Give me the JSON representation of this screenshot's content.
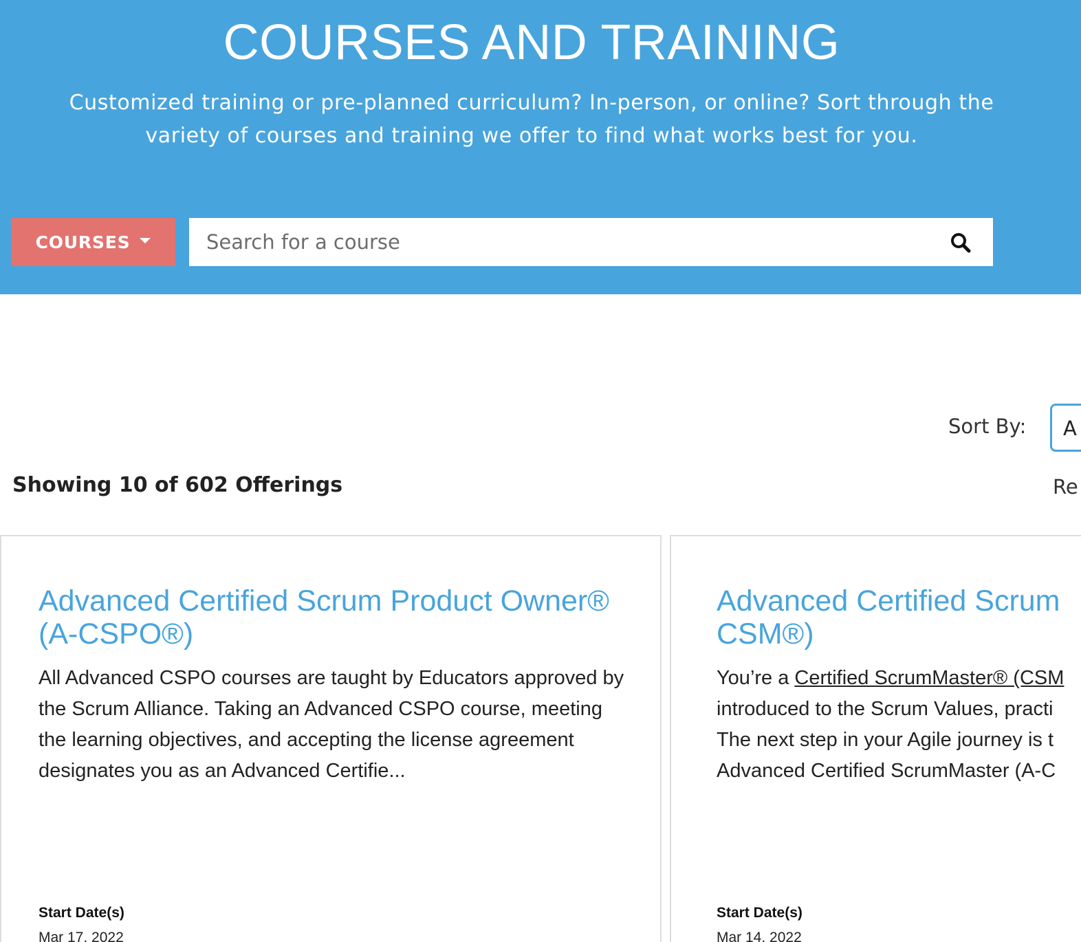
{
  "hero": {
    "title": "COURSES AND TRAINING",
    "subtitle": "Customized training or pre-planned curriculum? In-person, or online? Sort through the variety of courses and training we offer to find what works best for you."
  },
  "filters": {
    "dropdown_label": "COURSES",
    "search_placeholder": "Search for a course",
    "search_icon": "search-icon"
  },
  "toolbar": {
    "sort_label": "Sort By:",
    "sort_value": "A",
    "results_count": "Showing 10 of 602 Offerings",
    "reset_label": "Re"
  },
  "courses": [
    {
      "title": "Advanced Certified Scrum Product Owner® (A-CSPO®)",
      "description": "All Advanced CSPO courses are taught by Educators approved by the Scrum Alliance. Taking an Advanced CSPO course, meeting the learning objectives, and accepting the license agreement designates you as an Advanced Certifie...",
      "date_label": "Start Date(s)",
      "start_date": "Mar 17, 2022"
    },
    {
      "title_line1": "Advanced Certified Scrum",
      "title_line2": "CSM®)",
      "desc_prefix": "You’re a ",
      "desc_link": "Certified ScrumMaster® (CSM",
      "desc_line2": "introduced to the Scrum Values, practi",
      "desc_line3": "The next step in your Agile journey is t",
      "desc_line4": "Advanced Certified ScrumMaster (A-C",
      "date_label": "Start Date(s)",
      "start_date": "Mar 14, 2022"
    }
  ],
  "colors": {
    "hero_bg": "#48a4dc",
    "accent_button": "#e2736e",
    "link": "#48a4dc"
  }
}
